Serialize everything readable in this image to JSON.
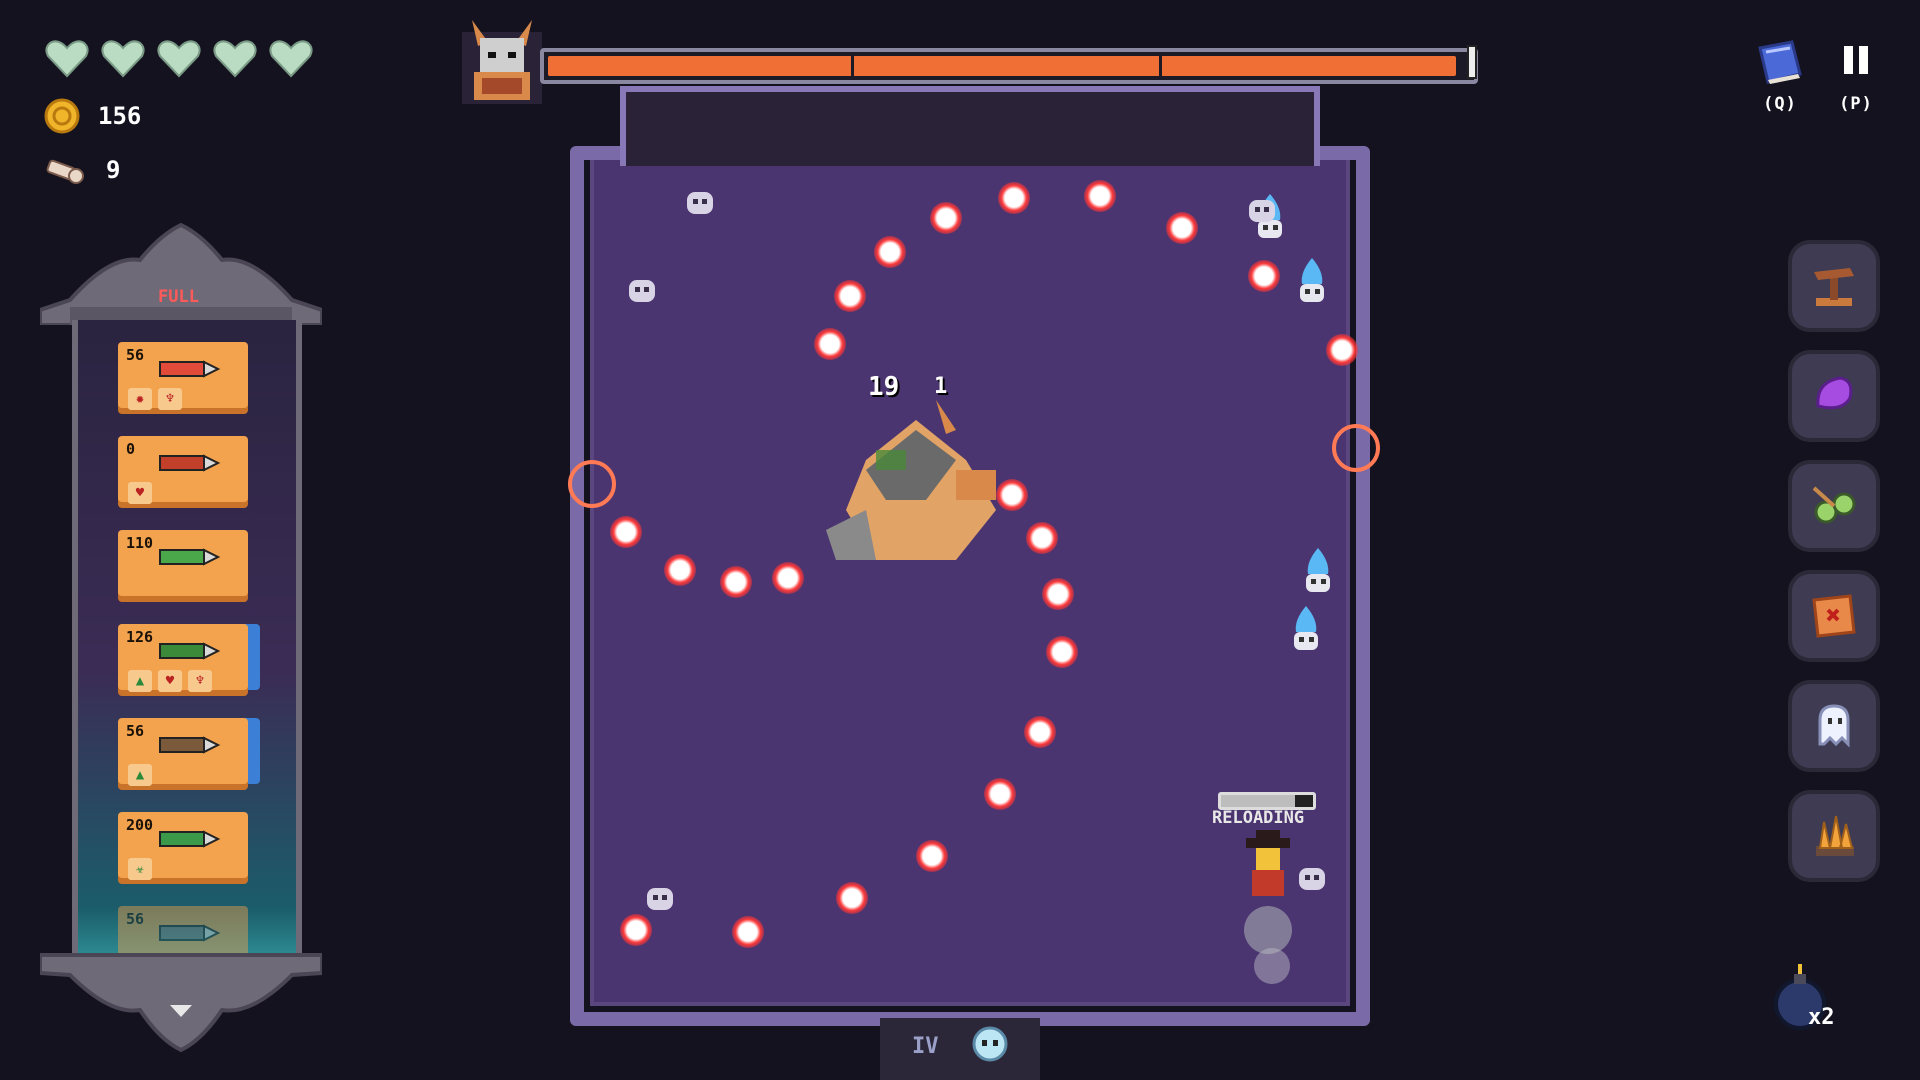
{
  "hud": {
    "hearts": {
      "full": 5,
      "max": 5,
      "color": "#b9dcc2"
    },
    "coins": {
      "icon": "coin-icon",
      "value": "156"
    },
    "keys": {
      "icon": "key-icon",
      "value": "9"
    }
  },
  "ammo_panel": {
    "status": "FULL",
    "items": [
      {
        "count": "56",
        "icon": "rocket-ammo-icon",
        "mods": [
          "explosion-icon",
          "chalice-icon"
        ]
      },
      {
        "count": "0",
        "icon": "fire-salamander-ammo-icon",
        "mods": [
          "heart-icon"
        ]
      },
      {
        "count": "110",
        "icon": "spark-bullet-ammo-icon",
        "mods": []
      },
      {
        "count": "126",
        "icon": "green-bullet-ammo-icon",
        "mods": [
          "arrow-up-icon",
          "broken-heart-icon",
          "chalice-icon"
        ],
        "mod_sub": [
          "1",
          "1"
        ]
      },
      {
        "count": "56",
        "icon": "shell-ammo-icon",
        "mods": [
          "arrow-up-icon"
        ]
      },
      {
        "count": "200",
        "icon": "poison-bullet-ammo-icon",
        "mods": [
          "poison-icon"
        ],
        "mod_sub": [
          "4"
        ]
      },
      {
        "count": "56",
        "icon": "faded-ammo-icon",
        "mods": []
      }
    ],
    "scroll_icon": "chevron-down-icon"
  },
  "boss": {
    "portrait_icon": "horned-boss-portrait-icon",
    "health_fraction": 0.985,
    "segments": 3,
    "bar_color": "#ef6f34"
  },
  "top_right": {
    "journal": {
      "icon": "journal-book-icon",
      "label": "(Q)"
    },
    "pause": {
      "icon": "pause-icon",
      "label": "(P)"
    }
  },
  "items": [
    {
      "icon": "crossbow-turret-icon"
    },
    {
      "icon": "purple-crystal-icon"
    },
    {
      "icon": "goggles-icon"
    },
    {
      "icon": "treasure-map-icon"
    },
    {
      "icon": "ghost-icon"
    },
    {
      "icon": "golden-crystals-icon"
    }
  ],
  "combat": {
    "damage_numbers": [
      "19",
      "1"
    ],
    "reload_text": "RELOADING",
    "reload_fraction": 0.8
  },
  "floor": {
    "label": "IV",
    "icon": "ghost-spirit-icon"
  },
  "bombs": {
    "icon": "bomb-icon",
    "count": "x2"
  }
}
